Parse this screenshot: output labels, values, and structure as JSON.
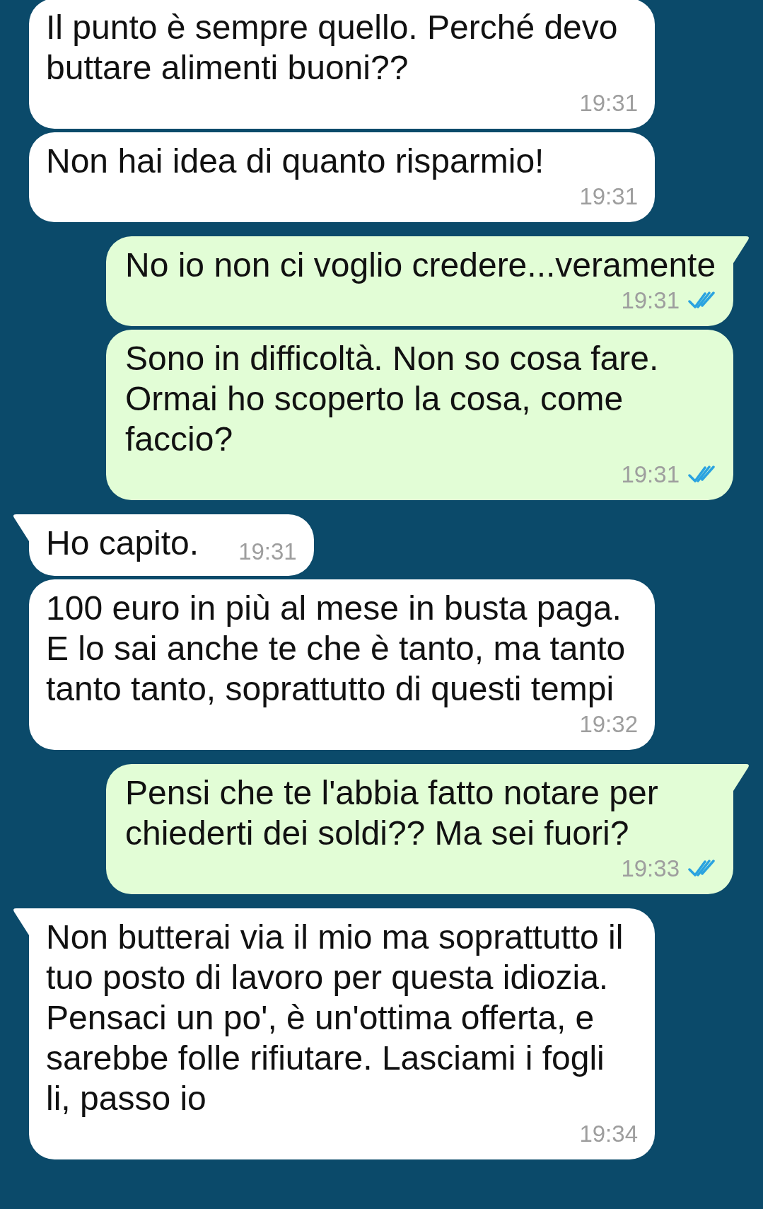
{
  "messages": [
    {
      "kind": "incoming",
      "tail": false,
      "compact": false,
      "text": "Il punto è sempre quello. Perché devo buttare alimenti buoni??",
      "time": "19:31"
    },
    {
      "kind": "incoming",
      "tail": false,
      "compact": false,
      "text": "Non hai idea di quanto risparmio!",
      "time": "19:31"
    },
    {
      "kind": "outgoing",
      "tail": true,
      "compact": false,
      "text": "No io non ci voglio credere...veramente",
      "time": "19:31",
      "read": true
    },
    {
      "kind": "outgoing",
      "tail": false,
      "compact": false,
      "text": "Sono in difficoltà. Non so cosa fare. Ormai ho scoperto la cosa, come faccio?",
      "time": "19:31",
      "read": true
    },
    {
      "kind": "incoming",
      "tail": true,
      "compact": true,
      "text": "Ho capito.",
      "time": "19:31"
    },
    {
      "kind": "incoming",
      "tail": false,
      "compact": false,
      "text": "100 euro in più al mese in busta paga. E lo sai anche te che è tanto, ma tanto tanto tanto, soprattutto di questi tempi",
      "time": "19:32"
    },
    {
      "kind": "outgoing",
      "tail": true,
      "compact": false,
      "text": "Pensi che te l'abbia fatto notare per chiederti dei soldi?? Ma sei fuori?",
      "time": "19:33",
      "read": true
    },
    {
      "kind": "incoming",
      "tail": true,
      "compact": false,
      "text": "Non butterai via il mio ma soprattutto il tuo posto di lavoro per questa idiozia. Pensaci un po', è un'ottima offerta, e sarebbe folle rifiutare. Lasciami i fogli li, passo io",
      "time": "19:34"
    }
  ]
}
